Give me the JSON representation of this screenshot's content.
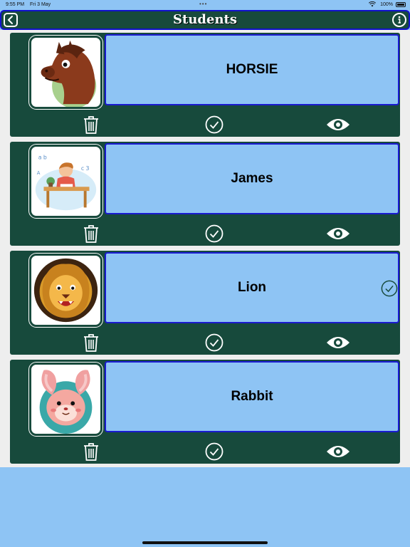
{
  "status_bar": {
    "time": "9:55 PM",
    "date": "Fri 3 May",
    "dots": "•••",
    "battery": "100%"
  },
  "nav": {
    "title": "Students"
  },
  "students": [
    {
      "name": "HORSIE",
      "avatar": "horse-icon",
      "selected": false
    },
    {
      "name": "James",
      "avatar": "boy-studying-icon",
      "selected": false
    },
    {
      "name": "Lion",
      "avatar": "lion-icon",
      "selected": true
    },
    {
      "name": "Rabbit",
      "avatar": "rabbit-icon",
      "selected": false
    }
  ],
  "colors": {
    "card": "#174a3c",
    "name_box": "#8ec4f4",
    "border": "#1a1ad0",
    "background": "#8ec4f4"
  }
}
